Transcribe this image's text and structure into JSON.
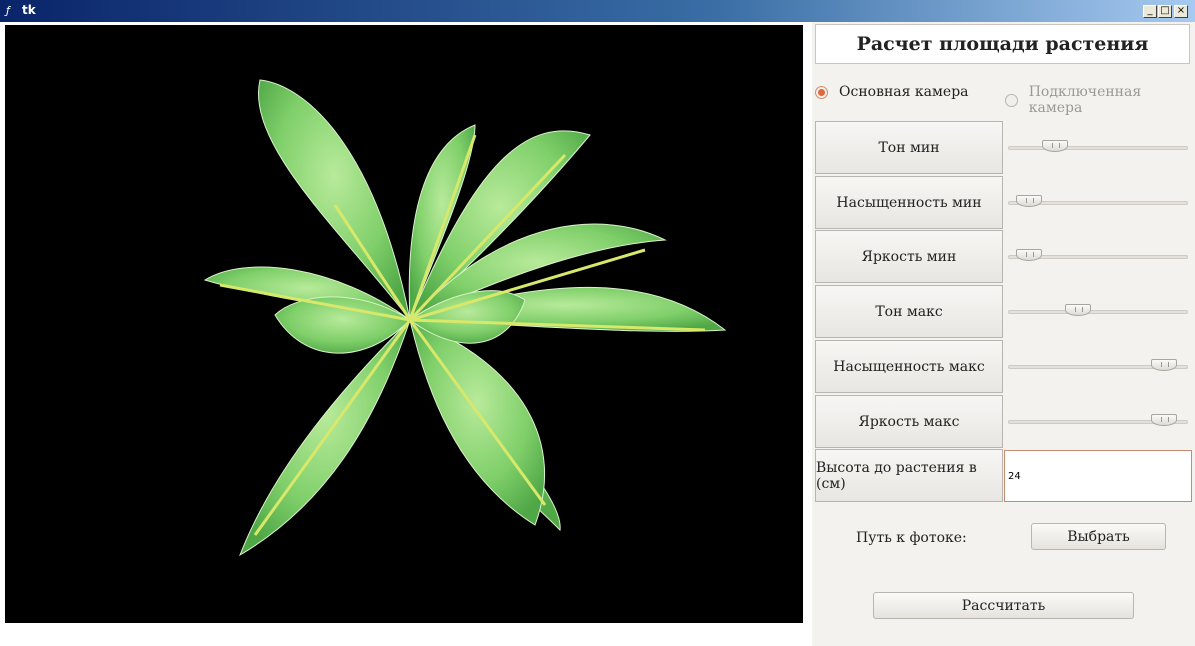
{
  "window": {
    "title": "tk"
  },
  "header": {
    "title": "Расчет площади растения"
  },
  "camera": {
    "main": "Основная камера",
    "connected": "Подключенная камера",
    "selected": "main"
  },
  "sliders": [
    {
      "label": "Тон мин",
      "value": 0.22
    },
    {
      "label": "Насыщенность мин",
      "value": 0.05
    },
    {
      "label": "Яркость мин",
      "value": 0.05
    },
    {
      "label": "Тон макс",
      "value": 0.37
    },
    {
      "label": "Насыщенность макс",
      "value": 0.93
    },
    {
      "label": "Яркость макс",
      "value": 0.93
    }
  ],
  "height": {
    "label": "Высота до растения в (см)",
    "value": "24"
  },
  "photo": {
    "label": "Путь к фотоке:",
    "choose_label": "Выбрать"
  },
  "calculate_label": "Рассчитать",
  "colors": {
    "accent": "#e0693c",
    "canvas_bg": "#000000",
    "leaf": "#7fcf6a"
  }
}
